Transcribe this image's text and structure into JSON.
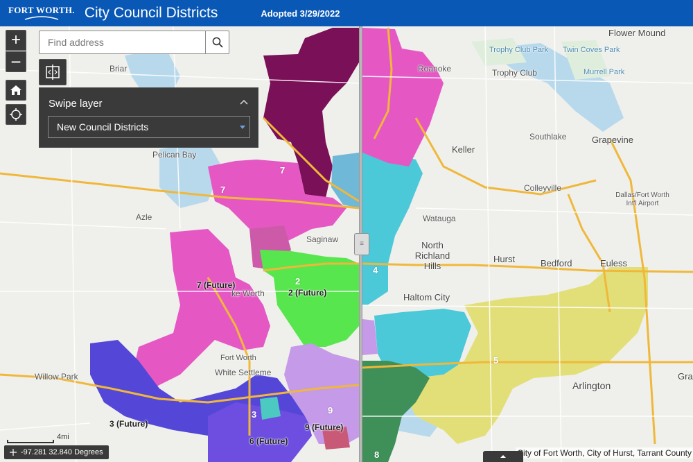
{
  "header": {
    "logo_text": "FORT WORTH.",
    "title": "City Council Districts",
    "subtitle": "Adopted 3/29/2022",
    "background": "#0a58b5"
  },
  "search": {
    "placeholder": "Find address"
  },
  "swipe_panel": {
    "title": "Swipe layer",
    "selected_layer": "New Council Districts"
  },
  "controls": {
    "zoom_in": "+",
    "zoom_out": "−",
    "icons": [
      "plus-icon",
      "minus-icon",
      "home-icon",
      "locate-icon",
      "swipe-icon",
      "search-icon",
      "chevron-up-icon",
      "dropdown-arrow-icon",
      "handle-icon",
      "expand-icon"
    ]
  },
  "scale": {
    "label": "4mi"
  },
  "coordinates": "-97.281 32.840 Degrees",
  "attribution": "City of Fort Worth, City of Hurst, Tarrant County",
  "district_colors": {
    "d2": "#58e64e",
    "d3": "#5447d8",
    "d4": "#4cc9d8",
    "d5": "#e2df78",
    "d6": "#6d4ee0",
    "d7": "#e558c4",
    "d8": "#3f8f58",
    "d9": "#c59ae8",
    "d10": "#7a1057"
  },
  "district_labels": [
    {
      "id": "d7a",
      "text": "7"
    },
    {
      "id": "d7b",
      "text": "7"
    },
    {
      "id": "d7f",
      "text": "7 (Future)"
    },
    {
      "id": "d2",
      "text": "2"
    },
    {
      "id": "d2f",
      "text": "2 (Future)"
    },
    {
      "id": "d4",
      "text": "4"
    },
    {
      "id": "d5",
      "text": "5"
    },
    {
      "id": "d3",
      "text": "3"
    },
    {
      "id": "d3f",
      "text": "3 (Future)"
    },
    {
      "id": "d9",
      "text": "9"
    },
    {
      "id": "d9f",
      "text": "9 (Future)"
    },
    {
      "id": "d6f",
      "text": "6 (Future)"
    },
    {
      "id": "d8",
      "text": "8"
    }
  ],
  "place_labels": [
    {
      "id": "flower-mound",
      "text": "Flower Mound"
    },
    {
      "id": "trophy-club-park",
      "text": "Trophy Club Park"
    },
    {
      "id": "twin-coves-park",
      "text": "Twin Coves Park"
    },
    {
      "id": "murrell-park",
      "text": "Murrell Park"
    },
    {
      "id": "roanoke",
      "text": "Roanoke"
    },
    {
      "id": "trophy-club",
      "text": "Trophy Club"
    },
    {
      "id": "briar",
      "text": "Briar"
    },
    {
      "id": "southlake",
      "text": "Southlake"
    },
    {
      "id": "grapevine",
      "text": "Grapevine"
    },
    {
      "id": "keller",
      "text": "Keller"
    },
    {
      "id": "pelican-bay",
      "text": "Pelican Bay"
    },
    {
      "id": "colleyville",
      "text": "Colleyville"
    },
    {
      "id": "dfw",
      "text": "Dallas/Fort Worth Int'l Airport"
    },
    {
      "id": "azle",
      "text": "Azle"
    },
    {
      "id": "watauga",
      "text": "Watauga"
    },
    {
      "id": "saginaw",
      "text": "Saginaw"
    },
    {
      "id": "north-richland-hills",
      "text": "North Richland Hills"
    },
    {
      "id": "hurst",
      "text": "Hurst"
    },
    {
      "id": "bedford",
      "text": "Bedford"
    },
    {
      "id": "euless",
      "text": "Euless"
    },
    {
      "id": "lake-worth",
      "text": "ke Worth"
    },
    {
      "id": "haltom-city",
      "text": "Haltom City"
    },
    {
      "id": "fort-worth",
      "text": "Fort Worth"
    },
    {
      "id": "white-settlement",
      "text": "White Settleme"
    },
    {
      "id": "willow-park",
      "text": "Willow Park"
    },
    {
      "id": "arlington",
      "text": "Arlington"
    },
    {
      "id": "grand",
      "text": "Gra"
    }
  ]
}
